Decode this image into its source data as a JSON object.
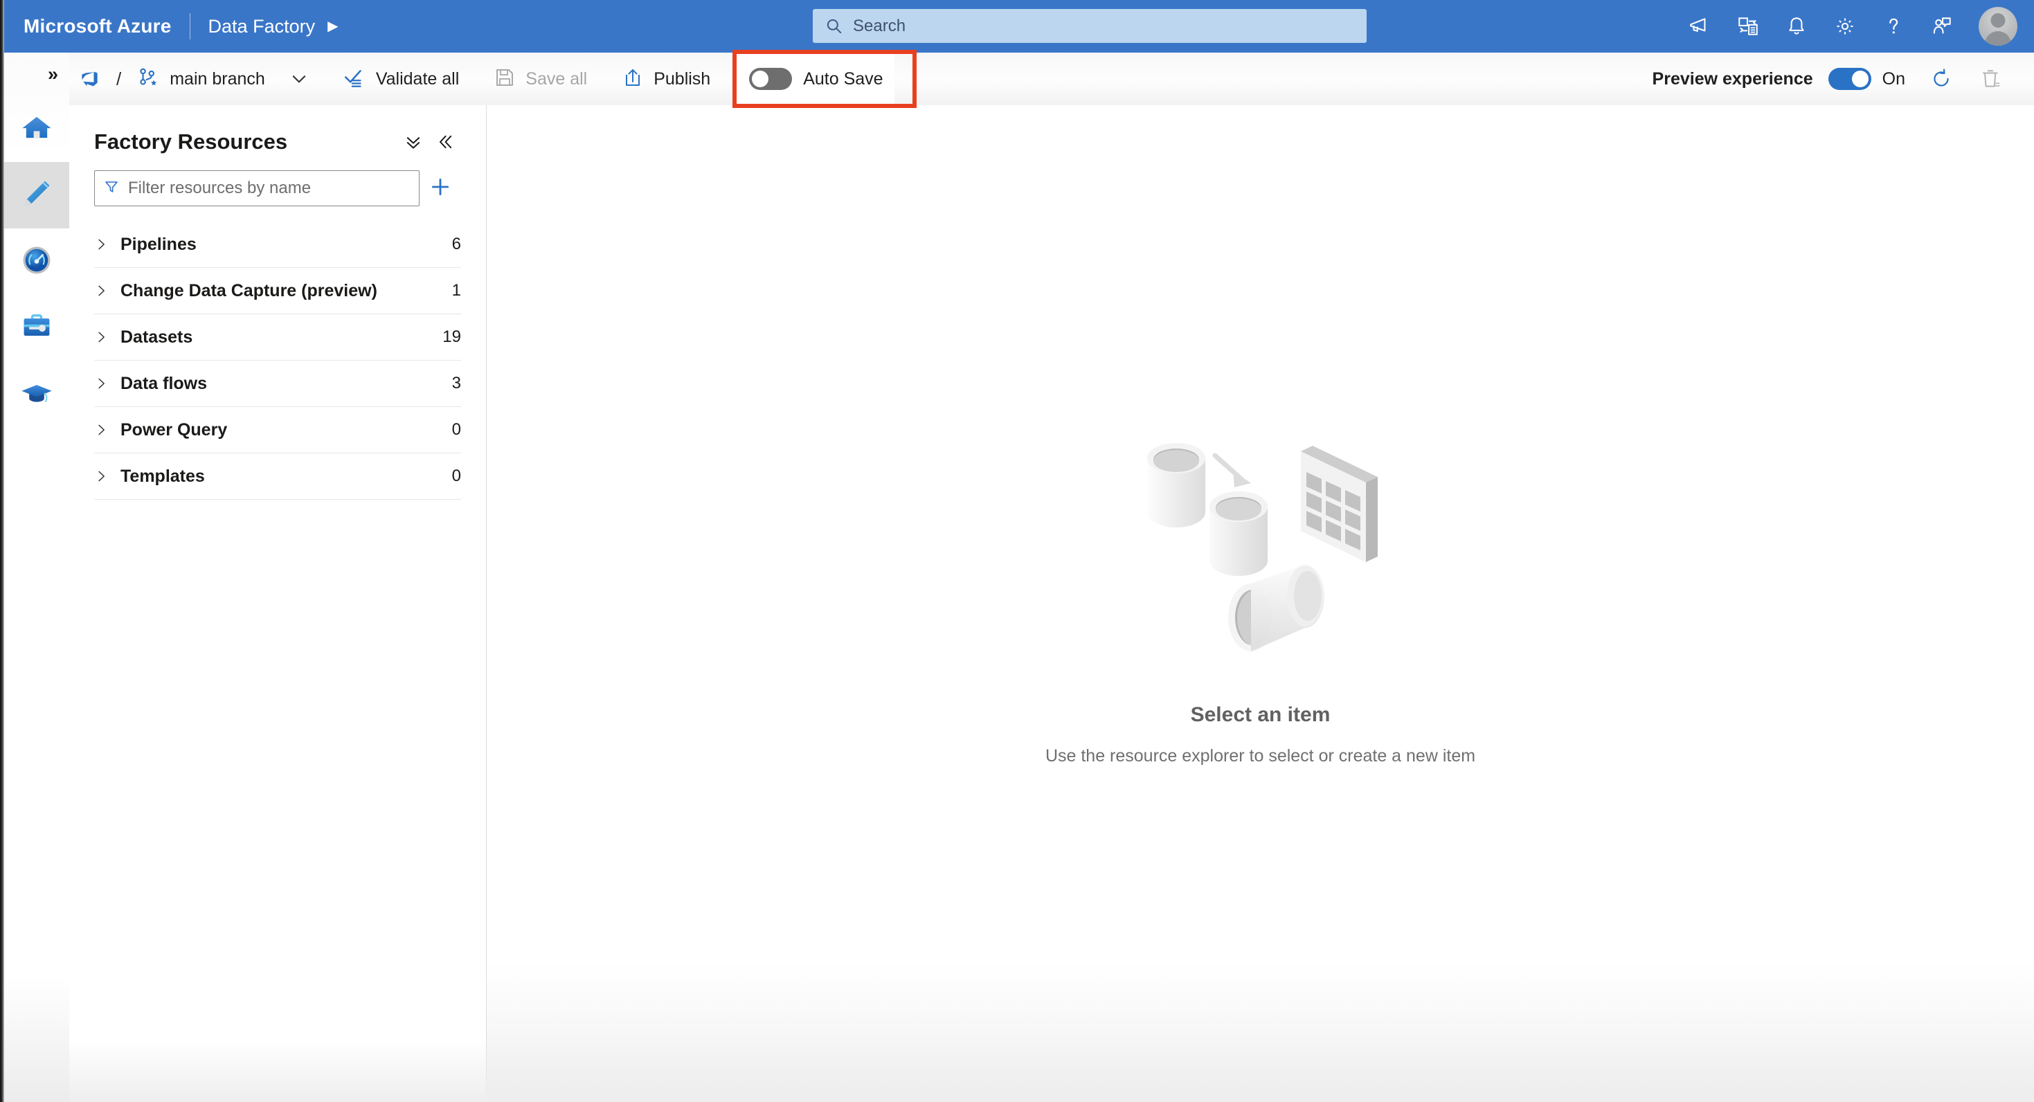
{
  "header": {
    "brand": "Microsoft Azure",
    "service": "Data Factory",
    "service_caret": "▶",
    "search": {
      "placeholder": "Search",
      "value": "",
      "icon": "search-icon"
    },
    "icons": [
      {
        "name": "announcements-icon",
        "title": "Announcements"
      },
      {
        "name": "cloud-shell-icon",
        "title": "Cloud Shell"
      },
      {
        "name": "notifications-bell-icon",
        "title": "Notifications"
      },
      {
        "name": "settings-gear-icon",
        "title": "Settings"
      },
      {
        "name": "help-question-icon",
        "title": "Help"
      },
      {
        "name": "feedback-icon",
        "title": "Feedback"
      }
    ],
    "avatar": "user-avatar"
  },
  "left_rail": {
    "expand_glyph": "»",
    "items": [
      {
        "name": "home",
        "label": "Home",
        "icon": "home-icon",
        "selected": false
      },
      {
        "name": "author",
        "label": "Author",
        "icon": "pencil-icon",
        "selected": true
      },
      {
        "name": "monitor",
        "label": "Monitor",
        "icon": "gauge-icon",
        "selected": false
      },
      {
        "name": "manage",
        "label": "Manage",
        "icon": "toolbox-icon",
        "selected": false
      },
      {
        "name": "learning-center",
        "label": "Learning center",
        "icon": "graduation-cap-icon",
        "selected": false
      }
    ]
  },
  "toolbar": {
    "repo_icon": "azure-devops-icon",
    "separator": "/",
    "branch_icon": "branch-star-icon",
    "branch_label": "main branch",
    "branch_caret": "chevron-down-icon",
    "validate_all": "Validate all",
    "save_all": "Save all",
    "save_all_disabled": true,
    "publish": "Publish",
    "auto_save": {
      "label": "Auto Save",
      "state": "off",
      "highlighted": true,
      "highlight_color": "#e8401f"
    },
    "preview_experience": {
      "label": "Preview experience",
      "state": "on",
      "state_label": "On"
    },
    "refresh_icon": "refresh-icon",
    "discard_icon": "discard-trash-icon"
  },
  "resources_panel": {
    "title": "Factory Resources",
    "collapse_all_icon": "double-chevron-down-icon",
    "collapse_panel_icon": "double-chevron-left-icon",
    "filter": {
      "placeholder": "Filter resources by name",
      "value": "",
      "icon": "filter-funnel-icon"
    },
    "add_button_icon": "plus-icon",
    "tree": [
      {
        "label": "Pipelines",
        "count": "6"
      },
      {
        "label": "Change Data Capture (preview)",
        "count": "1"
      },
      {
        "label": "Datasets",
        "count": "19"
      },
      {
        "label": "Data flows",
        "count": "3"
      },
      {
        "label": "Power Query",
        "count": "0"
      },
      {
        "label": "Templates",
        "count": "0"
      }
    ]
  },
  "canvas": {
    "illustration": "data-factory-empty-state-illustration",
    "title": "Select an item",
    "subtitle": "Use the resource explorer to select or create a new item"
  },
  "colors": {
    "azure_blue": "#3a76c8",
    "accent_blue": "#2a72c5",
    "highlight_red": "#e8401f",
    "search_bg": "#bcd6ef",
    "rail_selected": "#dedede"
  }
}
